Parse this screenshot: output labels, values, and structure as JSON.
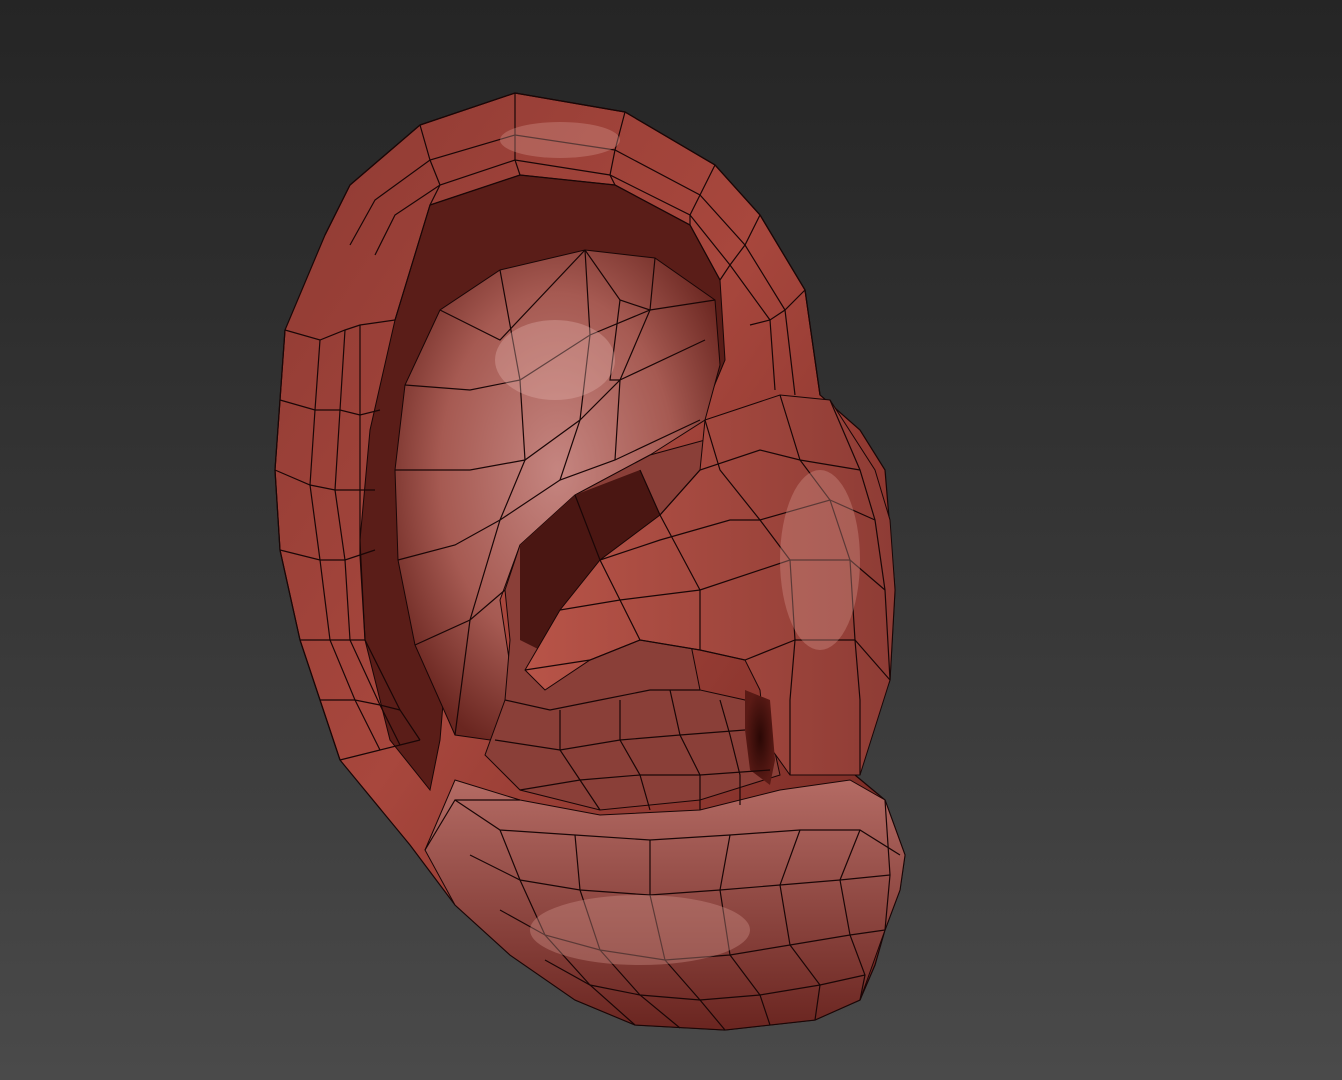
{
  "viewport": {
    "background_top": "#252525",
    "background_bottom": "#4a4a4a",
    "shading_mode": "clay-wireframe"
  },
  "model": {
    "subject": "ear-mesh",
    "base_color": "#a9463d",
    "highlight_color": "#c98a86",
    "shadow_color": "#3a0e0b",
    "wire_color": "#1a0606"
  }
}
